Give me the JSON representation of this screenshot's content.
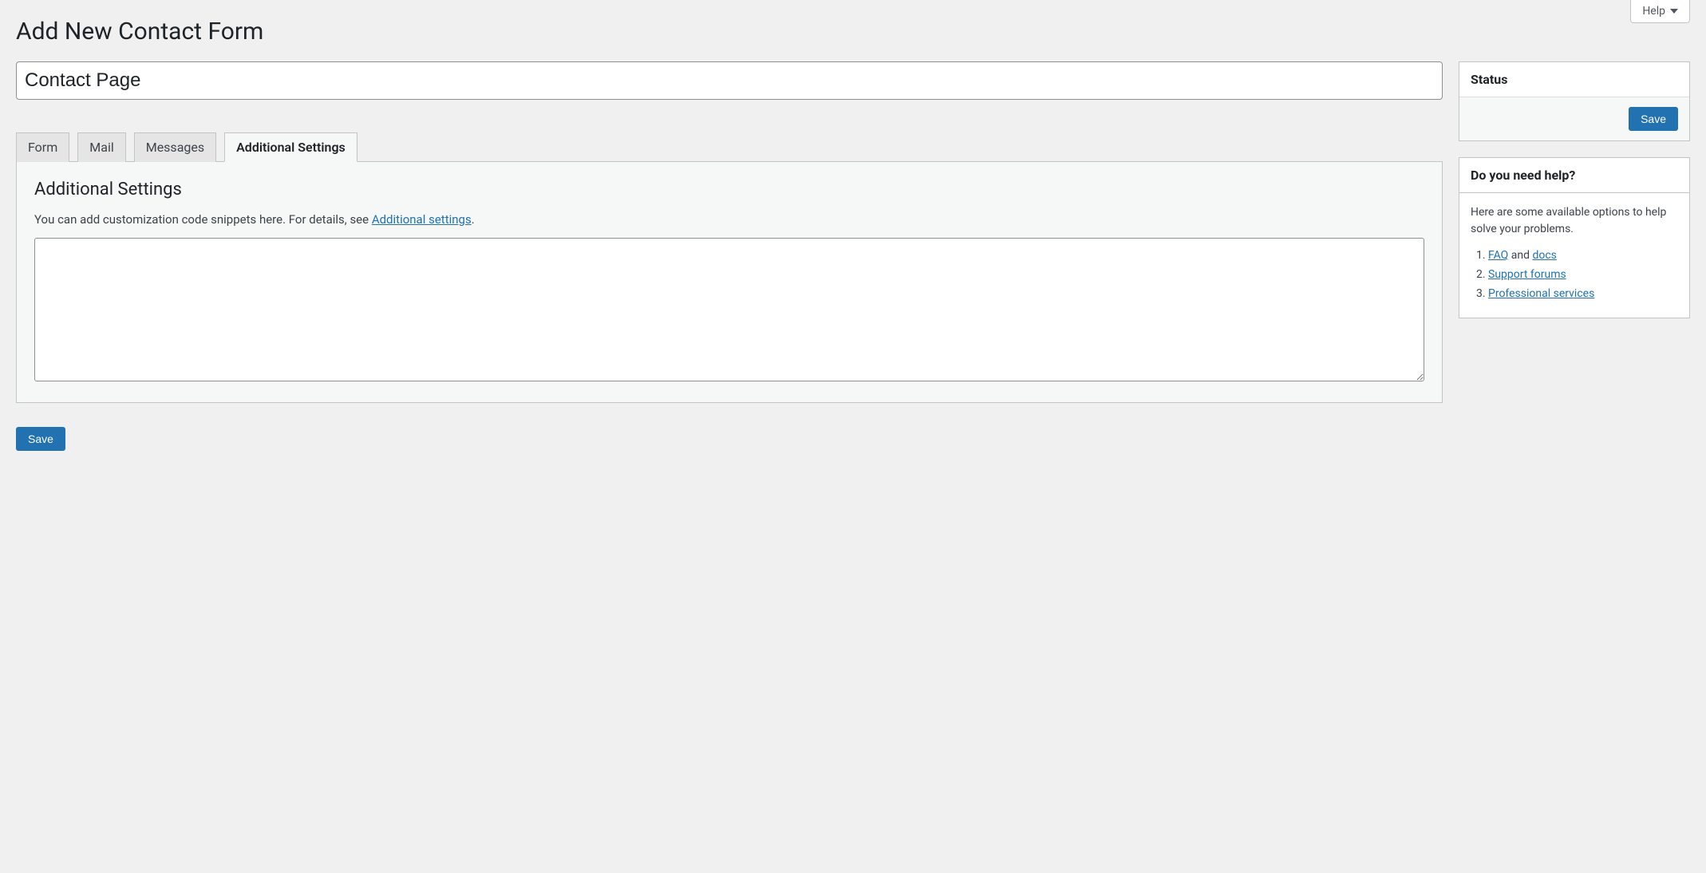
{
  "helpTab": {
    "label": "Help"
  },
  "header": {
    "title": "Add New Contact Form"
  },
  "form": {
    "titleValue": "Contact Page"
  },
  "tabs": {
    "form": "Form",
    "mail": "Mail",
    "messages": "Messages",
    "additional": "Additional Settings"
  },
  "panel": {
    "heading": "Additional Settings",
    "descPrefix": "You can add customization code snippets here. For details, see ",
    "descLink": "Additional settings",
    "descSuffix": ".",
    "textareaValue": ""
  },
  "buttons": {
    "save": "Save"
  },
  "sidebar": {
    "status": {
      "title": "Status"
    },
    "help": {
      "title": "Do you need help?",
      "intro": "Here are some available options to help solve your problems.",
      "items": {
        "faqLink": "FAQ",
        "andText": " and ",
        "docsLink": "docs",
        "supportForums": "Support forums",
        "proServices": "Professional services"
      }
    }
  }
}
